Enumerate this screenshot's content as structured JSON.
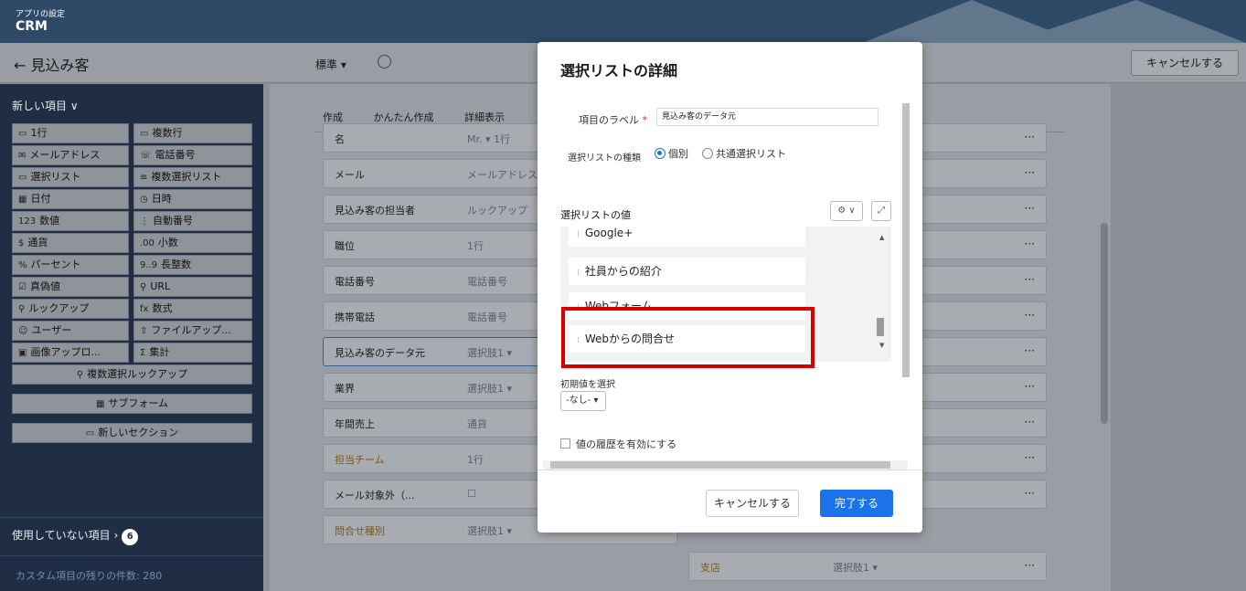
{
  "header": {
    "app_subtitle": "アプリの設定",
    "app_name": "CRM"
  },
  "subheader": {
    "back_label": "← 見込み客",
    "layout_label": "標準 ▾",
    "cancel_label": "キャンセルする"
  },
  "sidebar": {
    "new_items_label": "新しい項目 ∨",
    "fields": [
      {
        "icon": "▭",
        "label": "1行"
      },
      {
        "icon": "▭",
        "label": "複数行"
      },
      {
        "icon": "✉",
        "label": "メールアドレス"
      },
      {
        "icon": "☏",
        "label": "電話番号"
      },
      {
        "icon": "▭",
        "label": "選択リスト"
      },
      {
        "icon": "≡",
        "label": "複数選択リスト"
      },
      {
        "icon": "▦",
        "label": "日付"
      },
      {
        "icon": "◷",
        "label": "日時"
      },
      {
        "icon": "123",
        "label": "数値"
      },
      {
        "icon": "⋮",
        "label": "自動番号"
      },
      {
        "icon": "$",
        "label": "通貨"
      },
      {
        "icon": ".00",
        "label": "小数"
      },
      {
        "icon": "%",
        "label": "パーセント"
      },
      {
        "icon": "9..9",
        "label": "長整数"
      },
      {
        "icon": "☑",
        "label": "真偽値"
      },
      {
        "icon": "⚲",
        "label": "URL"
      },
      {
        "icon": "⚲",
        "label": "ルックアップ"
      },
      {
        "icon": "fx",
        "label": "数式"
      },
      {
        "icon": "☺",
        "label": "ユーザー"
      },
      {
        "icon": "⇧",
        "label": "ファイルアップ..."
      },
      {
        "icon": "▣",
        "label": "画像アップロ..."
      },
      {
        "icon": "Σ",
        "label": "集計"
      }
    ],
    "wide_fields": [
      {
        "icon": "⚲",
        "label": "複数選択ルックアップ"
      },
      {
        "icon": "▦",
        "label": "サブフォーム"
      },
      {
        "icon": "▭",
        "label": "新しいセクション"
      }
    ],
    "unused_label": "使用していない項目 ›",
    "unused_count": "6",
    "remaining_label": "カスタム項目の残りの件数: 280"
  },
  "canvas": {
    "tabs": [
      "作成",
      "かんたん作成",
      "詳細表示"
    ],
    "rows": [
      {
        "label": "名",
        "ph": "Mr. ▾  1行"
      },
      {
        "label": "メール",
        "ph": "メールアドレス"
      },
      {
        "label": "見込み客の担当者",
        "ph": "ルックアップ"
      },
      {
        "label": "職位",
        "ph": "1行"
      },
      {
        "label": "電話番号",
        "ph": "電話番号"
      },
      {
        "label": "携帯電話",
        "ph": "電話番号"
      },
      {
        "label": "見込み客のデータ元",
        "ph": "選択肢1 ▾"
      },
      {
        "label": "業界",
        "ph": "選択肢1 ▾"
      },
      {
        "label": "年間売上",
        "ph": "通貨"
      },
      {
        "label": "担当チーム",
        "ph": "1行"
      },
      {
        "label": "メール対象外（...",
        "ph": "☐"
      },
      {
        "label": "問合せ種別",
        "ph": "選択肢1 ▾"
      }
    ],
    "right_row": {
      "label": "支店",
      "ph": "選択肢1 ▾"
    }
  },
  "modal": {
    "title": "選択リストの詳細",
    "field_label": "項目のラベル",
    "required_mark": "*",
    "field_value": "見込み客のデータ元",
    "type_label": "選択リストの種類",
    "radio_individual": "個別",
    "radio_shared": "共通選択リスト",
    "values_label": "選択リストの値",
    "values": [
      "Google+",
      "社員からの紹介",
      "Webフォーム",
      "Webからの問合せ"
    ],
    "default_label": "初期値を選択",
    "default_value": "-なし- ▾",
    "history_label": "値の履歴を有効にする",
    "cancel_label": "キャンセルする",
    "done_label": "完了する"
  }
}
